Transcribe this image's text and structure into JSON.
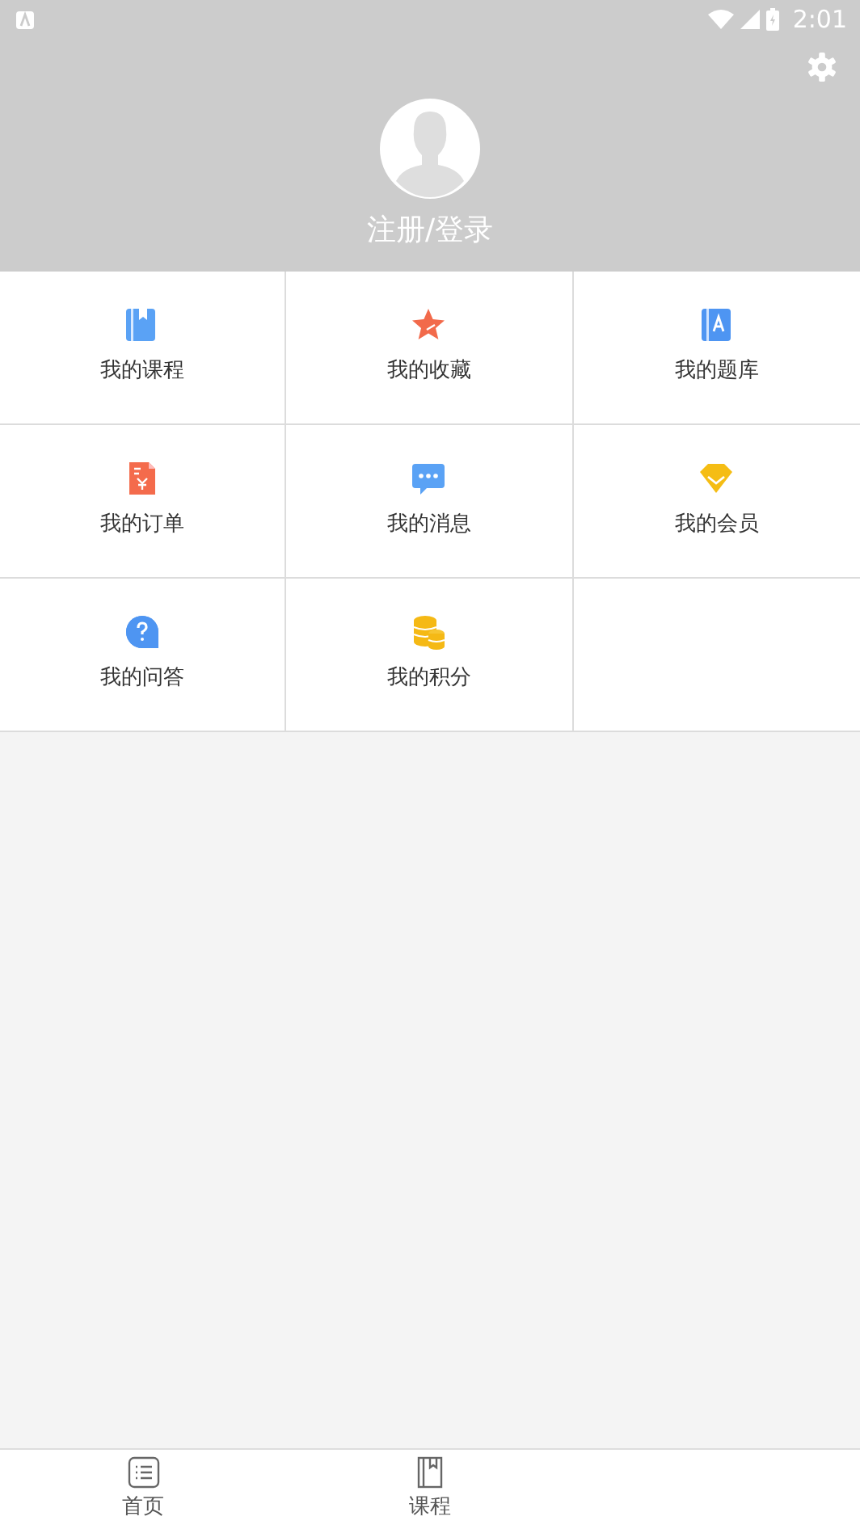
{
  "status_bar": {
    "time": "2:01"
  },
  "profile": {
    "login_label": "注册/登录"
  },
  "menu": [
    {
      "kind": "book",
      "label": "我的课程"
    },
    {
      "kind": "star",
      "label": "我的收藏"
    },
    {
      "kind": "quiz",
      "label": "我的题库"
    },
    {
      "kind": "order",
      "label": "我的订单"
    },
    {
      "kind": "message",
      "label": "我的消息"
    },
    {
      "kind": "member",
      "label": "我的会员"
    },
    {
      "kind": "question",
      "label": "我的问答"
    },
    {
      "kind": "coins",
      "label": "我的积分"
    }
  ],
  "bottom_nav": [
    {
      "kind": "home",
      "label": "首页"
    },
    {
      "kind": "course",
      "label": "课程"
    }
  ]
}
